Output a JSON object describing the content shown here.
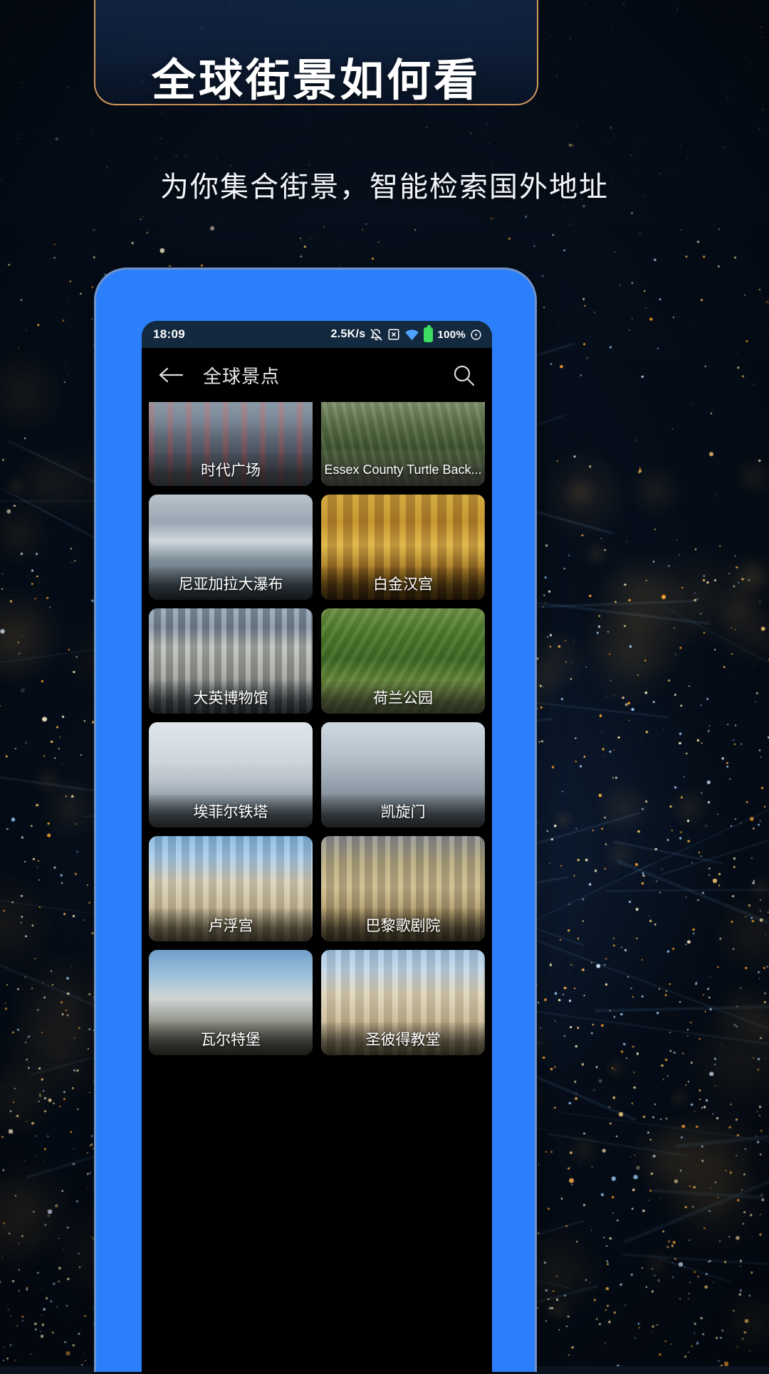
{
  "page": {
    "title": "全球街景如何看",
    "subtitle": "为你集合街景，智能检索国外地址",
    "accent_border": "#d2975a",
    "phone_color": "#2b7ffb"
  },
  "phone": {
    "statusbar": {
      "time": "18:09",
      "net_speed": "2.5K/s",
      "mute_icon": "bell-off-icon",
      "xbox_icon": "x-box-icon",
      "wifi_icon": "wifi-icon",
      "battery_icon": "battery-icon",
      "battery_pct": "100%",
      "charge_icon": "charging-icon"
    },
    "appbar": {
      "back_icon": "back-arrow-icon",
      "title": "全球景点",
      "search_icon": "search-icon"
    },
    "grid": {
      "cards": [
        {
          "label": "时代广场",
          "img": "times-square",
          "wide": false
        },
        {
          "label": "Essex County Turtle Back...",
          "img": "turtle-back",
          "wide": true
        },
        {
          "label": "尼亚加拉大瀑布",
          "img": "niagara",
          "wide": false
        },
        {
          "label": "白金汉宫",
          "img": "buckingham",
          "wide": false
        },
        {
          "label": "大英博物馆",
          "img": "british-museum",
          "wide": false
        },
        {
          "label": "荷兰公园",
          "img": "holland-park",
          "wide": false
        },
        {
          "label": "埃菲尔铁塔",
          "img": "eiffel",
          "wide": false
        },
        {
          "label": "凯旋门",
          "img": "arc-triomphe",
          "wide": false
        },
        {
          "label": "卢浮宫",
          "img": "louvre",
          "wide": false
        },
        {
          "label": "巴黎歌剧院",
          "img": "opera-garnier",
          "wide": false
        },
        {
          "label": "瓦尔特堡",
          "img": "wartburg",
          "wide": false
        },
        {
          "label": "圣彼得教堂",
          "img": "st-peters",
          "wide": false
        }
      ]
    }
  }
}
